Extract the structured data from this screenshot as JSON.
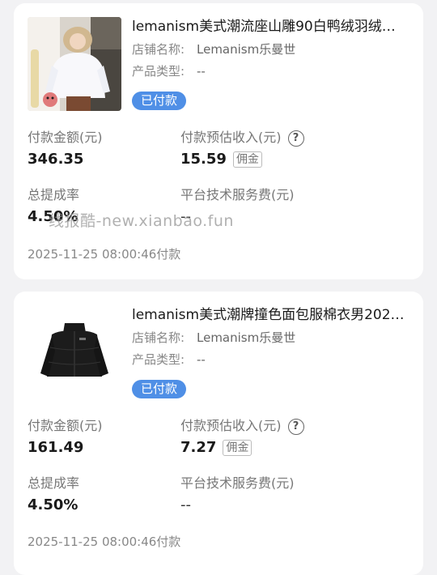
{
  "orders": [
    {
      "title": "lemanism美式潮流座山雕90白鸭绒羽绒服...",
      "shop_label": "店铺名称:",
      "shop_value": "Lemanism乐曼世",
      "type_label": "产品类型:",
      "type_value": "--",
      "status": "已付款",
      "pay_amount_label": "付款金额(元)",
      "pay_amount_value": "346.35",
      "est_income_label": "付款预估收入(元)",
      "est_income_value": "15.59",
      "commission_tag": "佣金",
      "rate_label": "总提成率",
      "rate_value": "4.50%",
      "fee_label": "平台技术服务费(元)",
      "fee_value": "--",
      "timestamp": "2025-11-25 08:00:46付款",
      "image_icon": "white-down-jacket-model-photo"
    },
    {
      "title": "lemanism美式潮牌撞色面包服棉衣男2025...",
      "shop_label": "店铺名称:",
      "shop_value": "Lemanism乐曼世",
      "type_label": "产品类型:",
      "type_value": "--",
      "status": "已付款",
      "pay_amount_label": "付款金额(元)",
      "pay_amount_value": "161.49",
      "est_income_label": "付款预估收入(元)",
      "est_income_value": "7.27",
      "commission_tag": "佣金",
      "rate_label": "总提成率",
      "rate_value": "4.50%",
      "fee_label": "平台技术服务费(元)",
      "fee_value": "--",
      "timestamp": "2025-11-25 08:00:46付款",
      "image_icon": "black-puffer-jacket-product-photo"
    }
  ],
  "help_icon": "?",
  "watermark": "线报酷-new.xianbao.fun",
  "colors": {
    "badge": "#4f8fe6",
    "background": "#f2f2f4",
    "card": "#ffffff"
  }
}
